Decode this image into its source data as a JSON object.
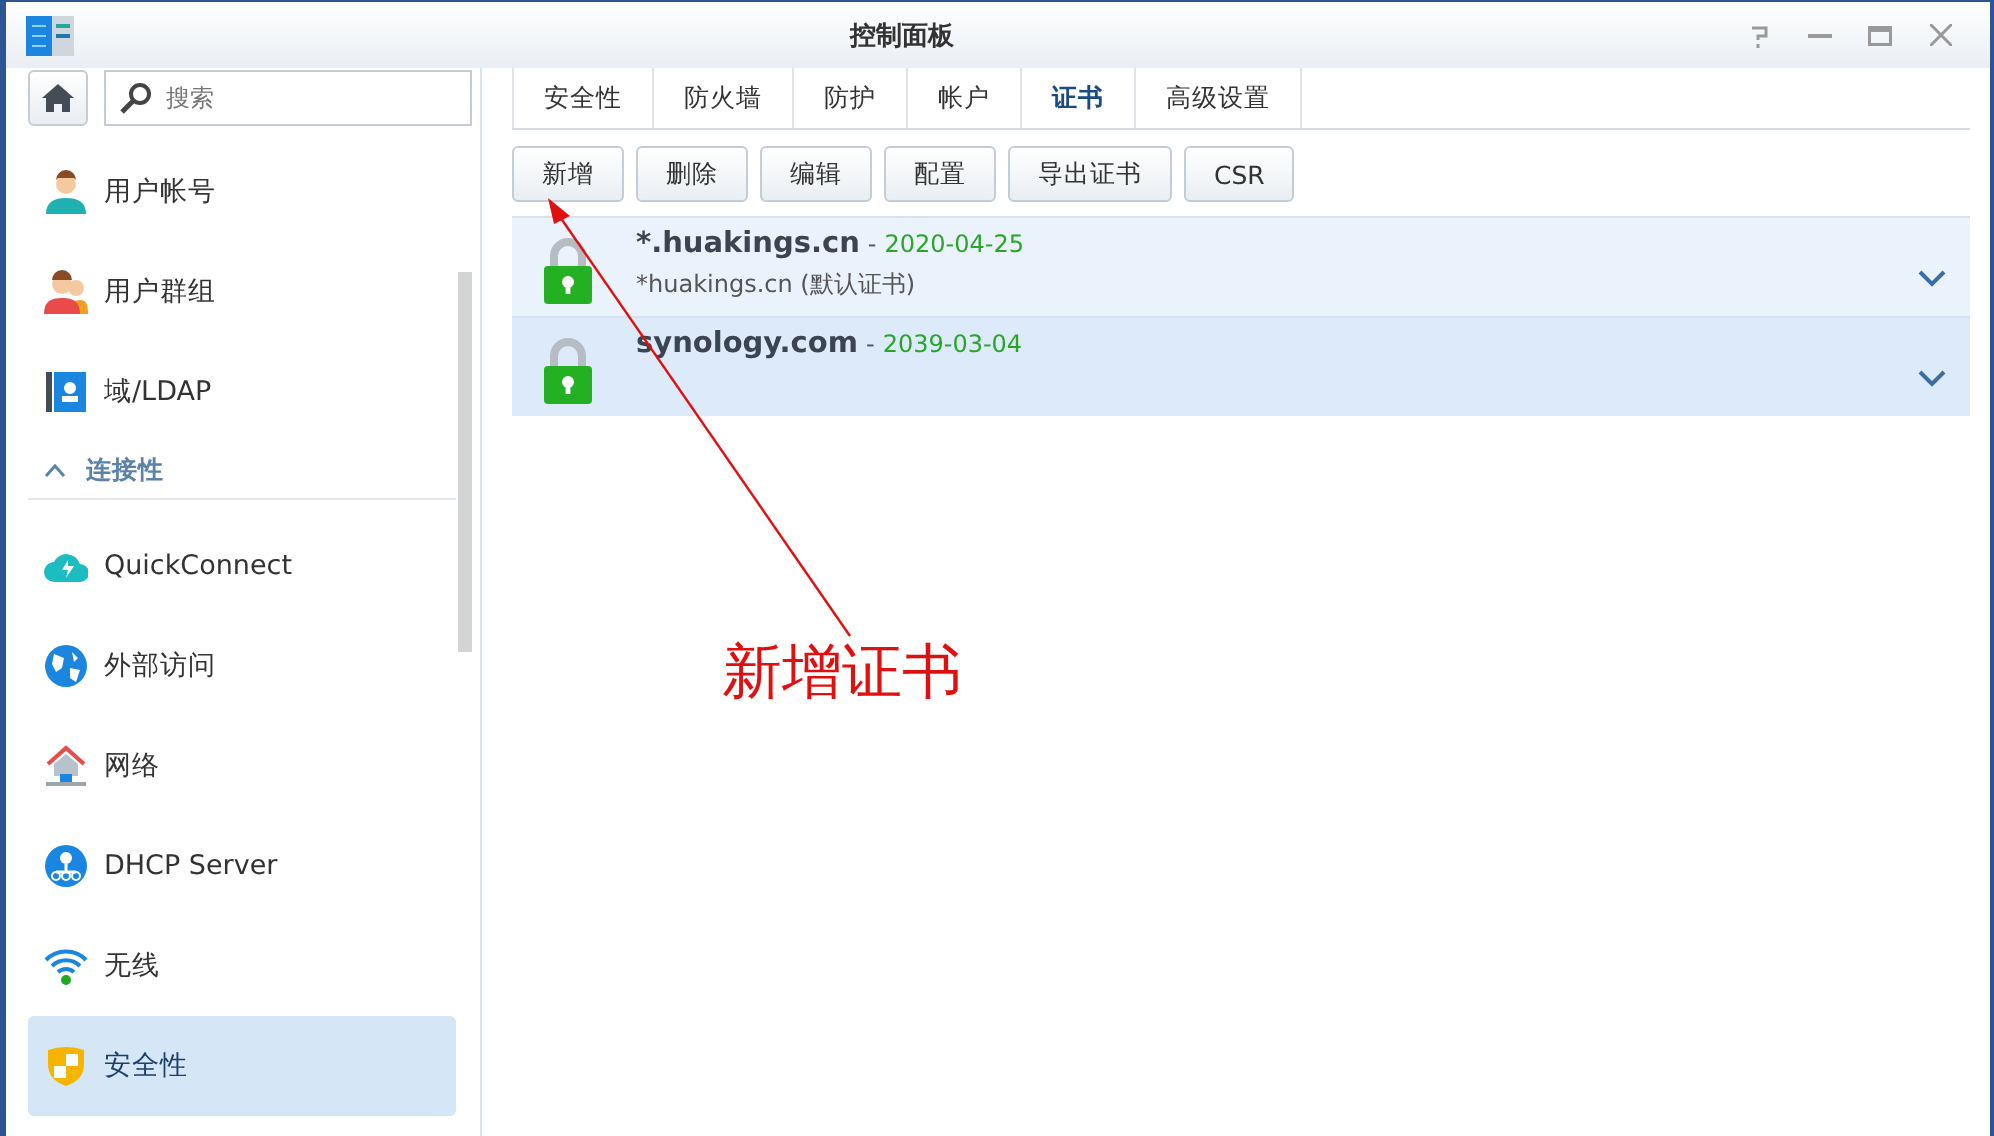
{
  "window": {
    "title": "控制面板"
  },
  "search": {
    "placeholder": "搜索"
  },
  "sidebar": {
    "items": [
      {
        "kind": "item",
        "label": "用户帐号",
        "selected": false
      },
      {
        "kind": "item",
        "label": "用户群组",
        "selected": false
      },
      {
        "kind": "item",
        "label": "域/LDAP",
        "selected": false
      },
      {
        "kind": "section",
        "label": "连接性",
        "expanded": true
      },
      {
        "kind": "item",
        "label": "QuickConnect",
        "selected": false
      },
      {
        "kind": "item",
        "label": "外部访问",
        "selected": false
      },
      {
        "kind": "item",
        "label": "网络",
        "selected": false
      },
      {
        "kind": "item",
        "label": "DHCP Server",
        "selected": false
      },
      {
        "kind": "item",
        "label": "无线",
        "selected": false
      },
      {
        "kind": "item",
        "label": "安全性",
        "selected": true
      }
    ]
  },
  "tabs": [
    {
      "label": "安全性",
      "selected": false
    },
    {
      "label": "防火墙",
      "selected": false
    },
    {
      "label": "防护",
      "selected": false
    },
    {
      "label": "帐户",
      "selected": false
    },
    {
      "label": "证书",
      "selected": true
    },
    {
      "label": "高级设置",
      "selected": false
    }
  ],
  "toolbar": [
    "新增",
    "删除",
    "编辑",
    "配置",
    "导出证书",
    "CSR"
  ],
  "certificates": [
    {
      "name": "*.huakings.cn",
      "separator": "-",
      "date": "2020-04-25",
      "description": "*huakings.cn (默认证书)",
      "selected": false
    },
    {
      "name": "synology.com",
      "separator": "-",
      "date": "2039-03-04",
      "selected": true
    }
  ],
  "annotation": {
    "text": "新增证书"
  }
}
